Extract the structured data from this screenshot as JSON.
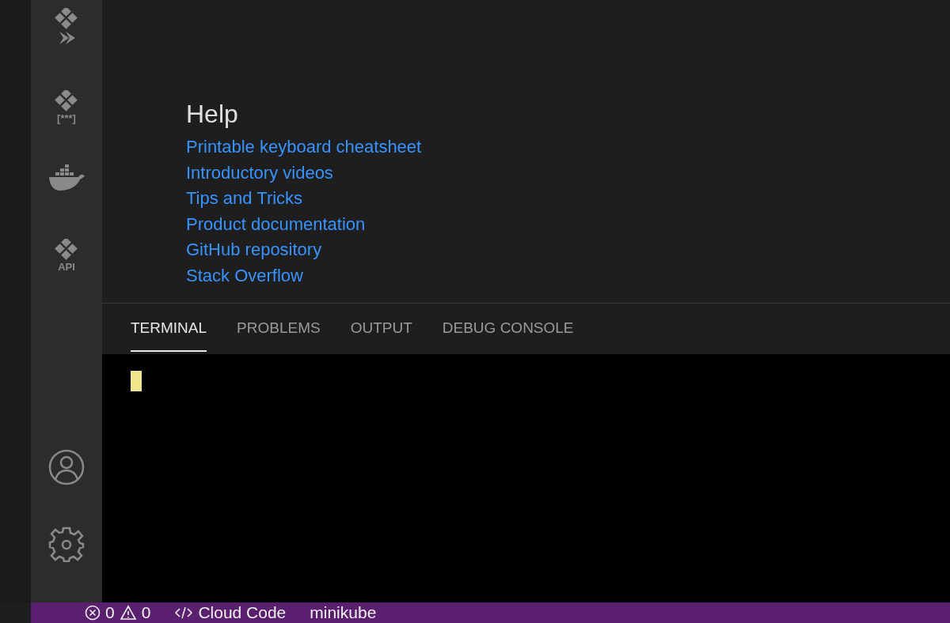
{
  "activity_bar": {
    "items": [
      {
        "kind": "run"
      },
      {
        "kind": "secrets",
        "caption": "[***]"
      },
      {
        "kind": "docker"
      },
      {
        "kind": "api",
        "caption": "API"
      }
    ],
    "bottom_items": [
      {
        "kind": "account"
      },
      {
        "kind": "settings"
      }
    ]
  },
  "help": {
    "title": "Help",
    "links": [
      "Printable keyboard cheatsheet",
      "Introductory videos",
      "Tips and Tricks",
      "Product documentation",
      "GitHub repository",
      "Stack Overflow"
    ]
  },
  "panel": {
    "tabs": [
      {
        "label": "TERMINAL",
        "selected": true
      },
      {
        "label": "PROBLEMS",
        "selected": false
      },
      {
        "label": "OUTPUT",
        "selected": false
      },
      {
        "label": "DEBUG CONSOLE",
        "selected": false
      }
    ]
  },
  "status_bar": {
    "errors": "0",
    "warnings": "0",
    "items": [
      "Cloud Code",
      "minikube"
    ]
  }
}
